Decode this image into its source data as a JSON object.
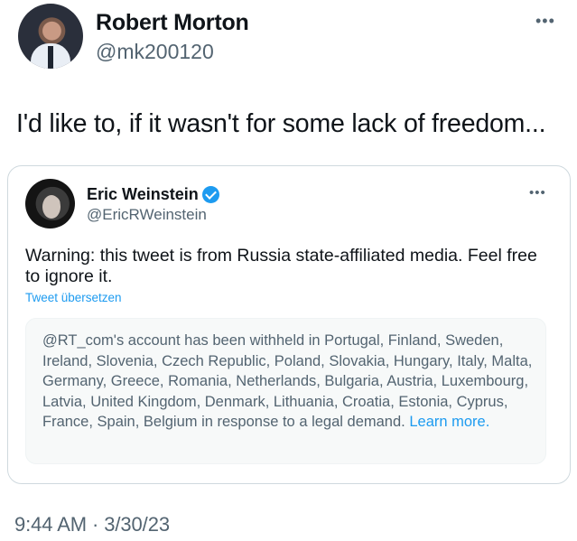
{
  "tweet": {
    "author": {
      "name": "Robert Morton",
      "handle": "@mk200120"
    },
    "more_icon": "more-horizontal-icon",
    "text": "I'd like to, if it wasn't for some lack of freedom...",
    "timestamp": "9:44 AM · 3/30/23"
  },
  "quoted_tweet": {
    "author": {
      "name": "Eric Weinstein",
      "handle": "@EricRWeinstein",
      "verified_icon": "verified-badge-icon",
      "verified_color": "#1d9bf0"
    },
    "more_icon": "more-horizontal-icon",
    "text": "Warning: this tweet is from Russia state-affiliated media. Feel free to ignore it.",
    "translate_label": "Tweet übersetzen",
    "withheld_notice": {
      "text": "@RT_com's account has been withheld in Portugal, Finland, Sweden, Ireland, Slovenia, Czech Republic, Poland, Slovakia, Hungary, Italy, Malta, Germany, Greece, Romania, Netherlands, Bulgaria, Austria, Luxembourg, Latvia, United Kingdom, Denmark, Lithuania, Croatia, Estonia, Cyprus, France, Spain, Belgium in response to a legal demand.",
      "link_label": "Learn more."
    }
  },
  "colors": {
    "text": "#0f1419",
    "secondary": "#536471",
    "link": "#1d9bf0",
    "border": "#cfd9de",
    "notice_bg": "#f7f9f9"
  }
}
